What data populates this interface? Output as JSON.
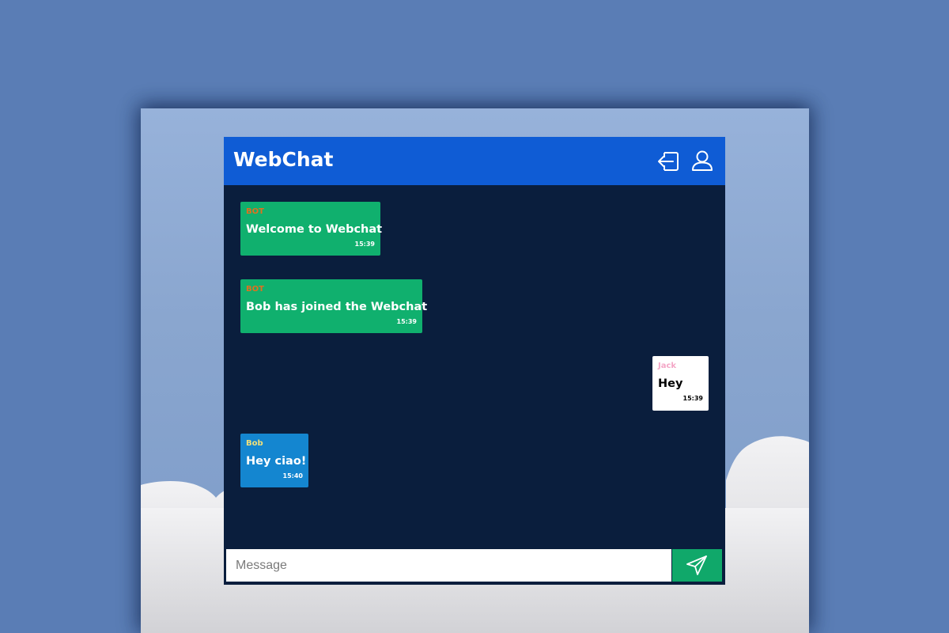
{
  "header": {
    "title": "WebChat",
    "icons": [
      "logout-icon",
      "user-icon"
    ]
  },
  "messages": [
    {
      "author": "BOT",
      "text": "Welcome to Webchat",
      "time": "15:39",
      "bg": "#10b06e",
      "author_color": "#e07020",
      "text_color": "#ffffff",
      "time_color": "#ffffff"
    },
    {
      "author": "BOT",
      "text": "Bob has joined the Webchat",
      "time": "15:39",
      "bg": "#10b06e",
      "author_color": "#e07020",
      "text_color": "#ffffff",
      "time_color": "#ffffff"
    },
    {
      "author": "Jack",
      "text": "Hey",
      "time": "15:39",
      "bg": "#ffffff",
      "author_color": "#f4a6c6",
      "text_color": "#000000",
      "time_color": "#000000"
    },
    {
      "author": "Bob",
      "text": "Hey ciao!",
      "time": "15:40",
      "bg": "#1486d0",
      "author_color": "#f1e07a",
      "text_color": "#ffffff",
      "time_color": "#ffffff"
    }
  ],
  "composer": {
    "placeholder": "Message",
    "value": ""
  },
  "colors": {
    "page_bg": "#5a7db5",
    "header_bg": "#0f5cd5",
    "chat_bg": "#0a1e3d",
    "send_bg": "#10a86a"
  }
}
